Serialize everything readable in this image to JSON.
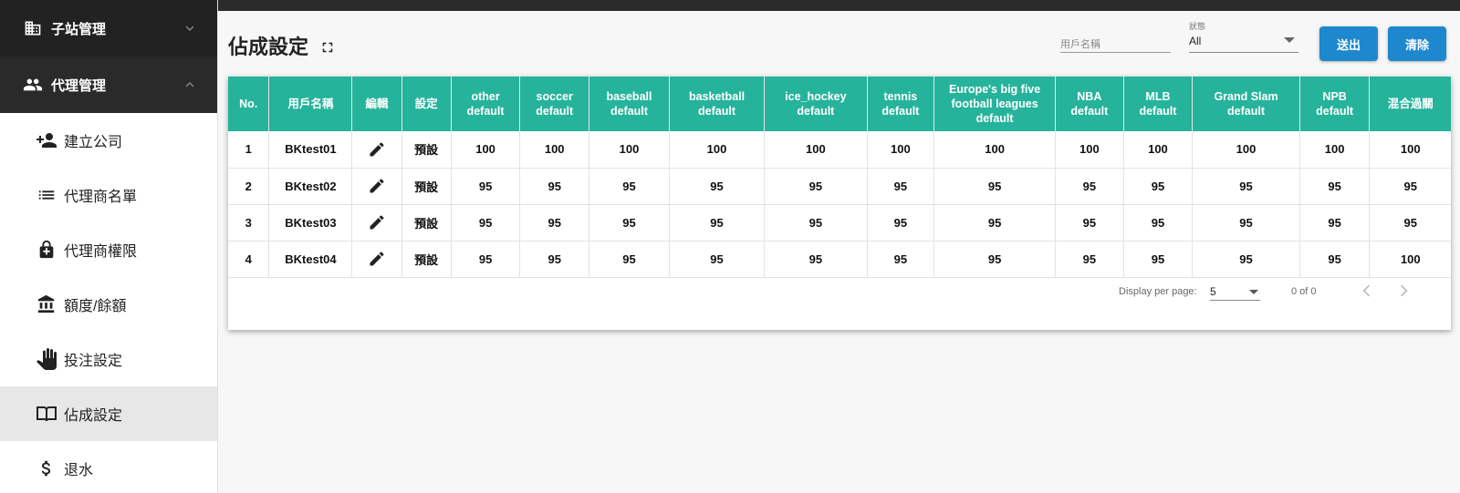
{
  "sidebar": {
    "sections": [
      {
        "label": "子站管理",
        "icon": "building-icon",
        "expanded": false
      },
      {
        "label": "代理管理",
        "icon": "people-icon",
        "expanded": true
      }
    ],
    "items": [
      {
        "label": "建立公司",
        "icon": "person-add-icon"
      },
      {
        "label": "代理商名單",
        "icon": "list-icon"
      },
      {
        "label": "代理商權限",
        "icon": "lock-icon"
      },
      {
        "label": "額度/餘額",
        "icon": "bank-icon"
      },
      {
        "label": "投注設定",
        "icon": "hand-icon"
      },
      {
        "label": "佔成設定",
        "icon": "book-icon",
        "active": true
      },
      {
        "label": "退水",
        "icon": "dollar-icon"
      }
    ]
  },
  "page": {
    "title": "佔成設定"
  },
  "filters": {
    "user_placeholder": "用戶名稱",
    "status_label": "狀態",
    "status_value": "All"
  },
  "buttons": {
    "send": "送出",
    "clear": "清除"
  },
  "table": {
    "headers": [
      "No.",
      "用戶名稱",
      "編輯",
      "設定",
      "other default",
      "soccer default",
      "baseball default",
      "basketball default",
      "ice_hockey default",
      "tennis default",
      "Europe's big five football leagues default",
      "NBA default",
      "MLB default",
      "Grand Slam default",
      "NPB default",
      "混合過關"
    ],
    "rows": [
      {
        "no": "1",
        "user": "BKtest01",
        "setting": "預設",
        "values": [
          "100",
          "100",
          "100",
          "100",
          "100",
          "100",
          "100",
          "100",
          "100",
          "100",
          "100",
          "100"
        ]
      },
      {
        "no": "2",
        "user": "BKtest02",
        "setting": "預設",
        "values": [
          "95",
          "95",
          "95",
          "95",
          "95",
          "95",
          "95",
          "95",
          "95",
          "95",
          "95",
          "95"
        ]
      },
      {
        "no": "3",
        "user": "BKtest03",
        "setting": "預設",
        "values": [
          "95",
          "95",
          "95",
          "95",
          "95",
          "95",
          "95",
          "95",
          "95",
          "95",
          "95",
          "95"
        ]
      },
      {
        "no": "4",
        "user": "BKtest04",
        "setting": "預設",
        "values": [
          "95",
          "95",
          "95",
          "95",
          "95",
          "95",
          "95",
          "95",
          "95",
          "95",
          "95",
          "100"
        ]
      }
    ]
  },
  "pagination": {
    "per_page_label": "Display per page:",
    "per_page_value": "5",
    "range": "0 of 0"
  },
  "colors": {
    "header_bg": "#26b39b",
    "button_bg": "#1e88cf",
    "sidebar_dark": "#222222"
  }
}
